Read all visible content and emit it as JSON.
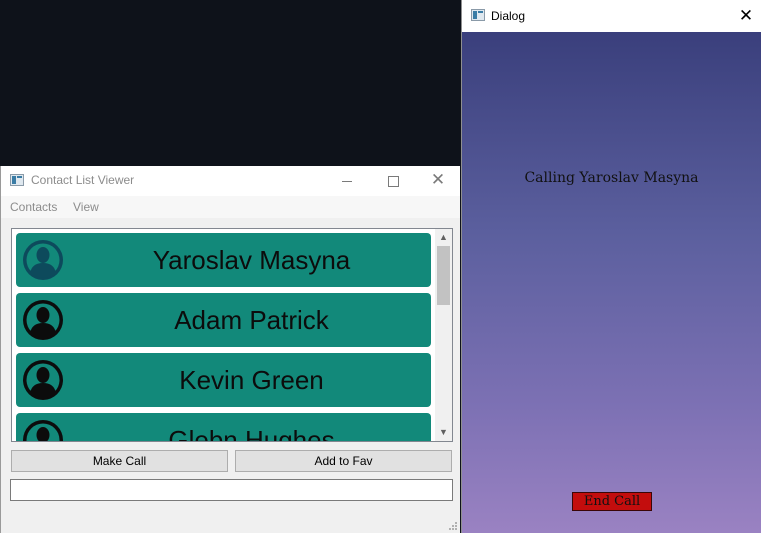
{
  "main_window": {
    "title": "Contact List Viewer",
    "menu": [
      "Contacts",
      "View"
    ],
    "contacts": [
      {
        "name": "Yaroslav Masyna",
        "avatar_color": "#0d4a5c"
      },
      {
        "name": "Adam Patrick",
        "avatar_color": "#0c0c0c"
      },
      {
        "name": "Kevin Green",
        "avatar_color": "#0c0c0c"
      },
      {
        "name": "Glebn Hughes",
        "avatar_color": "#0c0c0c"
      }
    ],
    "buttons": {
      "make_call": "Make Call",
      "add_fav": "Add to Fav"
    },
    "input": {
      "value": "",
      "placeholder": ""
    }
  },
  "dialog": {
    "title": "Dialog",
    "status_text": "Calling Yaroslav Masyna",
    "end_call_label": "End Call"
  },
  "colors": {
    "card": "#12897a",
    "end_call": "#c30d0d",
    "desktop": "#0e121a"
  }
}
